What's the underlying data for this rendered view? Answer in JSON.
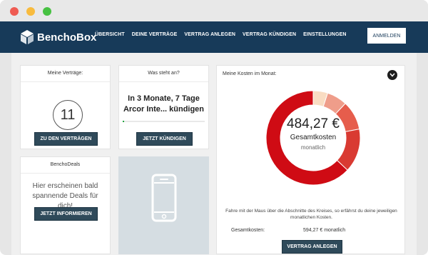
{
  "window": {
    "dots": [
      "#ef5b52",
      "#f8bb3e",
      "#47c142"
    ]
  },
  "brand": {
    "name": "BenchoBox",
    "logo_icon": "cube-logo-icon"
  },
  "nav": {
    "items": [
      "ÜBERSICHT",
      "DEINE VERTRÄGE",
      "VERTRAG ANLEGEN",
      "VERTRAG KÜNDIGEN",
      "EINSTELLUNGEN"
    ],
    "login_label": "ANMELDEN"
  },
  "contracts_card": {
    "title": "Meine Verträge:",
    "count": "11",
    "button": "ZU DEN VERTRÄGEN"
  },
  "deals_card": {
    "title": "BenchoDeals",
    "text": "Hier erscheinen bald spannende Deals für dich!",
    "button": "JETZT INFORMIEREN"
  },
  "next_card": {
    "title": "Was steht an?",
    "text": "In 3 Monate, 7 Tage Arcor Inte... kündigen",
    "progress": 0.02,
    "button": "JETZT KÜNDIGEN"
  },
  "phone_card": {
    "icon": "smartphone-icon"
  },
  "costs_card": {
    "title": "Meine Kosten im Monat:",
    "total_value": "484,27 €",
    "total_label": "Gesamtkosten",
    "total_sub": "monatlich",
    "hint": "Fahre mit der Maus über die Abschnitte des Kreises, so erfährst du deine jeweiligen monatlichen Kosten.",
    "summary_label": "Gesamtkosten:",
    "summary_value": "594,27 € monatlich",
    "button": "VERTRAG ANLEGEN"
  },
  "chart_data": {
    "type": "pie",
    "values": [
      5,
      7,
      10,
      15,
      63
    ],
    "colors": [
      "#f9dcc2",
      "#ef9d8a",
      "#e65d4c",
      "#d93a32",
      "#cf0b14"
    ]
  }
}
